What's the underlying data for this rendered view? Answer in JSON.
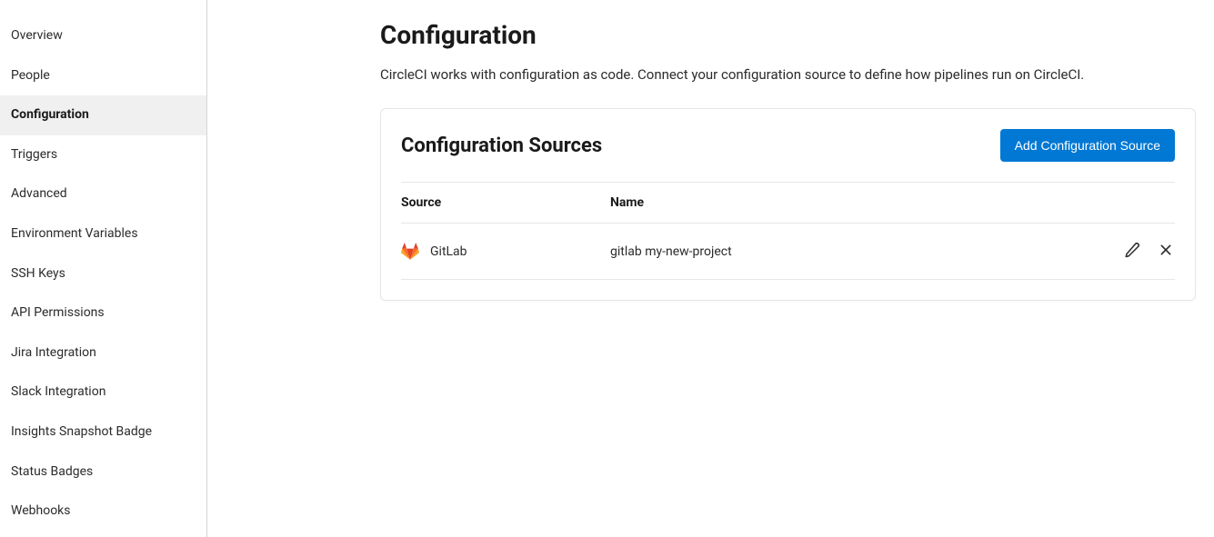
{
  "sidebar": {
    "items": [
      {
        "label": "Overview",
        "active": false
      },
      {
        "label": "People",
        "active": false
      },
      {
        "label": "Configuration",
        "active": true
      },
      {
        "label": "Triggers",
        "active": false
      },
      {
        "label": "Advanced",
        "active": false
      },
      {
        "label": "Environment Variables",
        "active": false
      },
      {
        "label": "SSH Keys",
        "active": false
      },
      {
        "label": "API Permissions",
        "active": false
      },
      {
        "label": "Jira Integration",
        "active": false
      },
      {
        "label": "Slack Integration",
        "active": false
      },
      {
        "label": "Insights Snapshot Badge",
        "active": false
      },
      {
        "label": "Status Badges",
        "active": false
      },
      {
        "label": "Webhooks",
        "active": false
      }
    ]
  },
  "page": {
    "title": "Configuration",
    "description": "CircleCI works with configuration as code. Connect your configuration source to define how pipelines run on CircleCI."
  },
  "card": {
    "title": "Configuration Sources",
    "add_button": "Add Configuration Source",
    "columns": {
      "source": "Source",
      "name": "Name"
    },
    "rows": [
      {
        "provider": "GitLab",
        "name": "gitlab my-new-project",
        "icon": "gitlab"
      }
    ]
  },
  "colors": {
    "primary": "#0078d4",
    "gitlab": "#fc6d26"
  }
}
